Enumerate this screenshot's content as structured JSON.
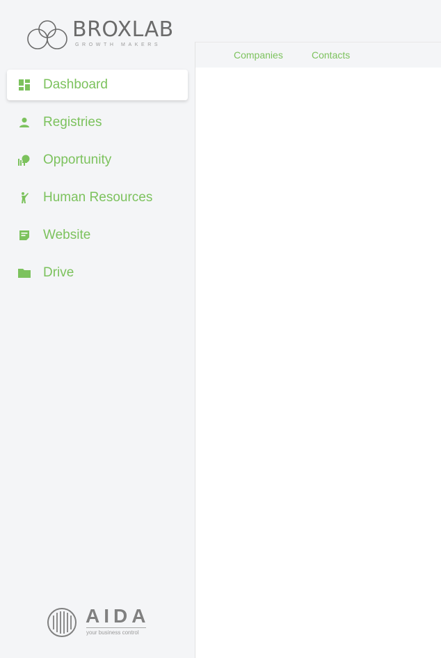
{
  "brand": {
    "name": "BROXLAB",
    "tagline": "GROWTH MAKERS"
  },
  "sidebar": {
    "items": [
      {
        "label": "Dashboard",
        "icon": "dashboard-icon",
        "active": true
      },
      {
        "label": "Registries",
        "icon": "person-icon",
        "active": false
      },
      {
        "label": "Opportunity",
        "icon": "opportunity-icon",
        "active": false
      },
      {
        "label": "Human Resources",
        "icon": "human-resources-icon",
        "active": false
      },
      {
        "label": "Website",
        "icon": "website-icon",
        "active": false
      },
      {
        "label": "Drive",
        "icon": "folder-icon",
        "active": false
      }
    ]
  },
  "topbar": {
    "tabs": [
      {
        "label": "Companies"
      },
      {
        "label": "Contacts"
      }
    ]
  },
  "footer_logo": {
    "name": "AIDA",
    "tagline": "your business control"
  },
  "colors": {
    "accent": "#7cc25d",
    "sidebar_bg": "#f4f5f7",
    "content_bg": "#ffffff",
    "logo_gray": "#6b6b6b"
  }
}
